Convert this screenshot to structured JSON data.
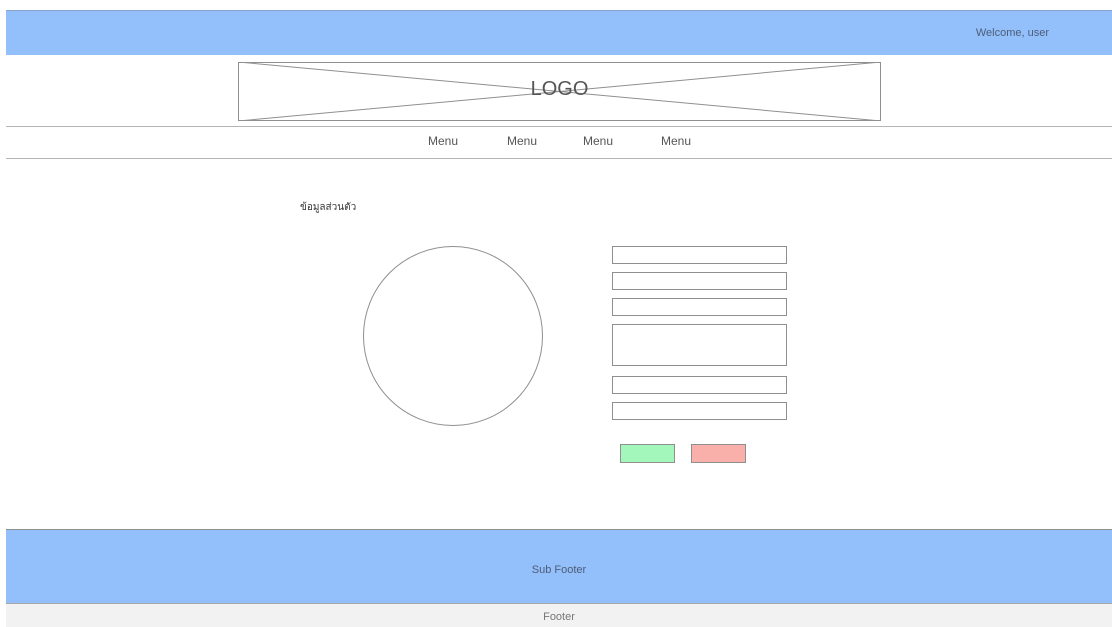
{
  "header": {
    "welcome_text": "Welcome, user"
  },
  "logo": {
    "text": "LOGO"
  },
  "menu": {
    "items": [
      "Menu",
      "Menu",
      "Menu",
      "Menu"
    ]
  },
  "profile": {
    "section_title": "ข้อมูลส่วนตัว"
  },
  "form": {
    "fields": [
      {
        "value": "",
        "placeholder": ""
      },
      {
        "value": "",
        "placeholder": ""
      },
      {
        "value": "",
        "placeholder": ""
      },
      {
        "value": "",
        "placeholder": ""
      },
      {
        "value": "",
        "placeholder": ""
      },
      {
        "value": "",
        "placeholder": ""
      }
    ]
  },
  "sub_footer": {
    "text": "Sub Footer"
  },
  "footer": {
    "text": "Footer"
  },
  "colors": {
    "header_bg": "#93bffb",
    "subfooter_bg": "#93bffb",
    "footer_bg": "#f2f2f2",
    "confirm_button": "#a3f7bb",
    "cancel_button": "#f9b0aa"
  }
}
